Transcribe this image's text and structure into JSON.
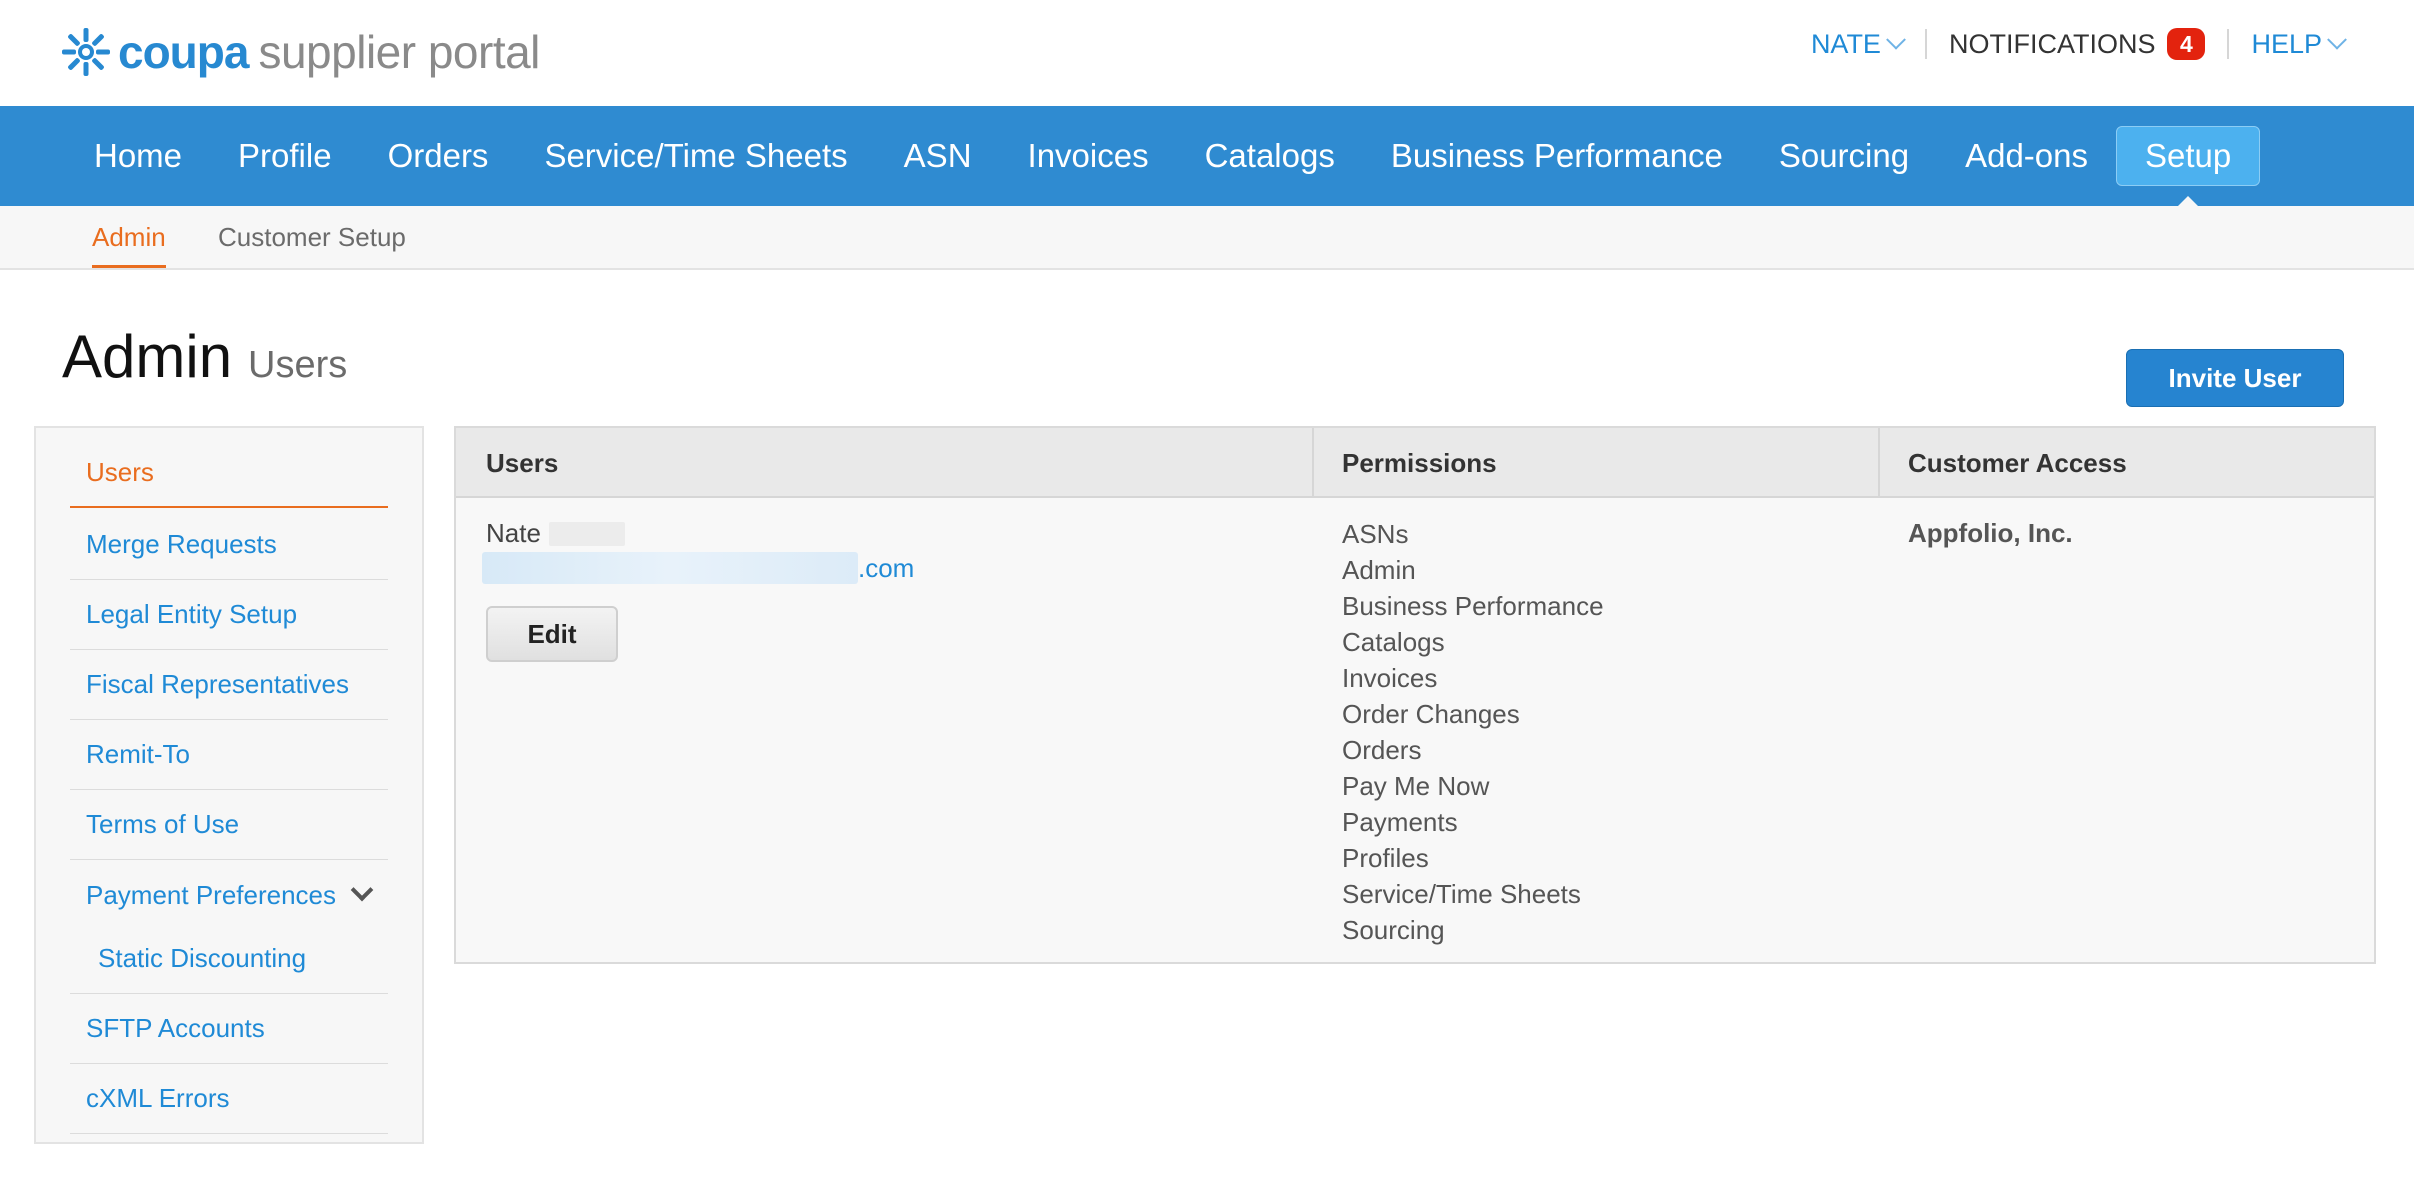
{
  "brand": {
    "name_bold": "coupa",
    "name_rest": "supplier portal",
    "accent_color": "#2f8bd1",
    "highlight_color": "#e96d1f"
  },
  "top_links": {
    "user": "NATE",
    "notifications": "NOTIFICATIONS",
    "notification_count": "4",
    "help": "HELP"
  },
  "main_nav": {
    "items": [
      {
        "label": "Home"
      },
      {
        "label": "Profile"
      },
      {
        "label": "Orders"
      },
      {
        "label": "Service/Time Sheets"
      },
      {
        "label": "ASN"
      },
      {
        "label": "Invoices"
      },
      {
        "label": "Catalogs"
      },
      {
        "label": "Business Performance"
      },
      {
        "label": "Sourcing"
      },
      {
        "label": "Add-ons"
      },
      {
        "label": "Setup"
      }
    ],
    "active_index": 10
  },
  "sub_nav": {
    "items": [
      {
        "label": "Admin"
      },
      {
        "label": "Customer Setup"
      }
    ]
  },
  "page": {
    "title": "Admin",
    "subtitle": "Users",
    "invite_button": "Invite User"
  },
  "sidebar": {
    "items": [
      {
        "label": "Users"
      },
      {
        "label": "Merge Requests"
      },
      {
        "label": "Legal Entity Setup"
      },
      {
        "label": "Fiscal Representatives"
      },
      {
        "label": "Remit-To"
      },
      {
        "label": "Terms of Use"
      },
      {
        "label": "Payment Preferences",
        "icon": "chevron-down-icon"
      },
      {
        "label": "Static Discounting"
      },
      {
        "label": "SFTP Accounts"
      },
      {
        "label": "cXML Errors"
      }
    ]
  },
  "users_table": {
    "headers": [
      "Users",
      "Permissions",
      "Customer Access"
    ],
    "rows": [
      {
        "name": "Nate",
        "email_suffix": ".com",
        "edit_label": "Edit",
        "permissions": [
          "ASNs",
          "Admin",
          "Business Performance",
          "Catalogs",
          "Invoices",
          "Order Changes",
          "Orders",
          "Pay Me Now",
          "Payments",
          "Profiles",
          "Service/Time Sheets",
          "Sourcing"
        ],
        "customer_access": "Appfolio, Inc."
      }
    ]
  }
}
